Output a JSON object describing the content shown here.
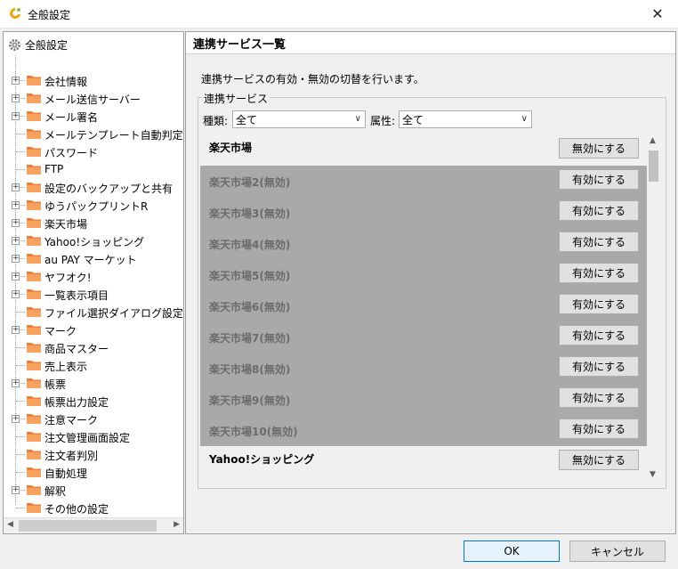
{
  "window": {
    "title": "全般設定",
    "close_glyph": "✕"
  },
  "tree": {
    "root_label": "全般設定",
    "items": [
      {
        "label": "会社情報",
        "expandable": true
      },
      {
        "label": "メール送信サーバー",
        "expandable": true
      },
      {
        "label": "メール署名",
        "expandable": true
      },
      {
        "label": "メールテンプレート自動判定",
        "expandable": false
      },
      {
        "label": "パスワード",
        "expandable": false
      },
      {
        "label": "FTP",
        "expandable": false
      },
      {
        "label": "設定のバックアップと共有",
        "expandable": true
      },
      {
        "label": "ゆうパックプリントR",
        "expandable": true
      },
      {
        "label": "楽天市場",
        "expandable": true
      },
      {
        "label": "Yahoo!ショッピング",
        "expandable": true
      },
      {
        "label": "au PAY マーケット",
        "expandable": true
      },
      {
        "label": "ヤフオク!",
        "expandable": true
      },
      {
        "label": "一覧表示項目",
        "expandable": true
      },
      {
        "label": "ファイル選択ダイアログ設定",
        "expandable": false
      },
      {
        "label": "マーク",
        "expandable": true
      },
      {
        "label": "商品マスター",
        "expandable": false
      },
      {
        "label": "売上表示",
        "expandable": false
      },
      {
        "label": "帳票",
        "expandable": true
      },
      {
        "label": "帳票出力設定",
        "expandable": false
      },
      {
        "label": "注意マーク",
        "expandable": true
      },
      {
        "label": "注文管理画面設定",
        "expandable": false
      },
      {
        "label": "注文者判別",
        "expandable": false
      },
      {
        "label": "自動処理",
        "expandable": false
      },
      {
        "label": "解釈",
        "expandable": true
      },
      {
        "label": "その他の設定",
        "expandable": false
      },
      {
        "label": "連携サービス一覧",
        "expandable": false,
        "selected": true
      }
    ]
  },
  "panel": {
    "title": "連携サービス一覧",
    "description": "連携サービスの有効・無効の切替を行います。",
    "group_label": "連携サービス",
    "type_label": "種類:",
    "type_value": "全て",
    "attr_label": "属性:",
    "attr_value": "全て",
    "services": [
      {
        "name": "楽天市場",
        "enabled": true,
        "button": "無効にする"
      },
      {
        "name": "楽天市場2(無効)",
        "enabled": false,
        "button": "有効にする"
      },
      {
        "name": "楽天市場3(無効)",
        "enabled": false,
        "button": "有効にする"
      },
      {
        "name": "楽天市場4(無効)",
        "enabled": false,
        "button": "有効にする"
      },
      {
        "name": "楽天市場5(無効)",
        "enabled": false,
        "button": "有効にする"
      },
      {
        "name": "楽天市場6(無効)",
        "enabled": false,
        "button": "有効にする"
      },
      {
        "name": "楽天市場7(無効)",
        "enabled": false,
        "button": "有効にする"
      },
      {
        "name": "楽天市場8(無効)",
        "enabled": false,
        "button": "有効にする"
      },
      {
        "name": "楽天市場9(無効)",
        "enabled": false,
        "button": "有効にする"
      },
      {
        "name": "楽天市場10(無効)",
        "enabled": false,
        "button": "有効にする"
      },
      {
        "name": "Yahoo!ショッピング",
        "enabled": true,
        "button": "無効にする"
      }
    ]
  },
  "buttons": {
    "ok": "OK",
    "cancel": "キャンセル"
  },
  "colors": {
    "selected": "#0078d7",
    "disabled_row": "#a9a9a9",
    "folder": "#f0813a"
  }
}
